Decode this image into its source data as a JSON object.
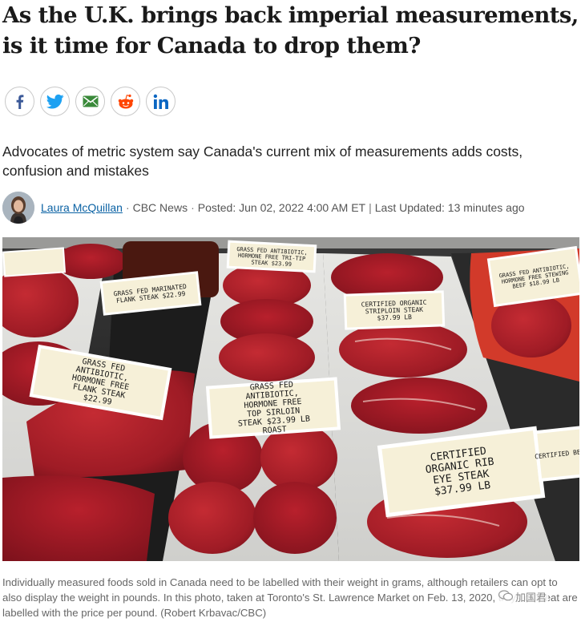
{
  "article": {
    "headline": "As the U.K. brings back imperial measurements, is it time for Canada to drop them?",
    "dek": "Advocates of metric system say Canada's current mix of measurements adds costs, confusion and mistakes",
    "author": "Laura McQuillan",
    "source": "CBC News",
    "posted": "Posted: Jun 02, 2022 4:00 AM ET",
    "updated": "Last Updated: 13 minutes ago",
    "caption": "Individually measured foods sold in Canada need to be labelled with their weight in grams, although retailers can opt to also display the weight in pounds. In this photo, taken at Toronto's St. Lawrence Market on Feb. 13, 2020, trays of meat are labelled with the price per pound. (Robert Krbavac/CBC)"
  },
  "share": {
    "buttons": [
      {
        "name": "facebook",
        "icon": "facebook-icon",
        "color": "#3b5998"
      },
      {
        "name": "twitter",
        "icon": "twitter-icon",
        "color": "#1da1f2"
      },
      {
        "name": "email",
        "icon": "email-icon",
        "color": "#3a8a3a"
      },
      {
        "name": "reddit",
        "icon": "reddit-icon",
        "color": "#ff4500"
      },
      {
        "name": "linkedin",
        "icon": "linkedin-icon",
        "color": "#0a66c2"
      }
    ]
  },
  "photo": {
    "labels": [
      {
        "text": "GRASS FED MARINATED FLANK STEAK $22.99"
      },
      {
        "text": "GRASS FED ANTIBIOTIC, HORMONE FREE TRI-TIP STEAK $23.99"
      },
      {
        "text": "CERTIFIED ORGANIC STRIPLOIN STEAK $37.99 LB"
      },
      {
        "text": "GRASS FED ANTIBIOTIC, HORMONE FREE STEWING BEEF $18.99 LB"
      },
      {
        "text": "GRASS FED ANTIBIOTIC, HORMONE FREE FLANK STEAK $22.99"
      },
      {
        "text": "GRASS FED ANTIBIOTIC, HORMONE FREE TOP SIRLOIN STEAK $23.99 LB ROAST"
      },
      {
        "text": "CERTIFIED ORGANIC RIB EYE STEAK $37.99 LB"
      },
      {
        "text": "CERTIFIED BEEF"
      }
    ]
  },
  "watermark": {
    "text": "加国君"
  },
  "colors": {
    "link": "#0b62a4",
    "headline": "#1a1a1a",
    "caption": "#666666"
  }
}
